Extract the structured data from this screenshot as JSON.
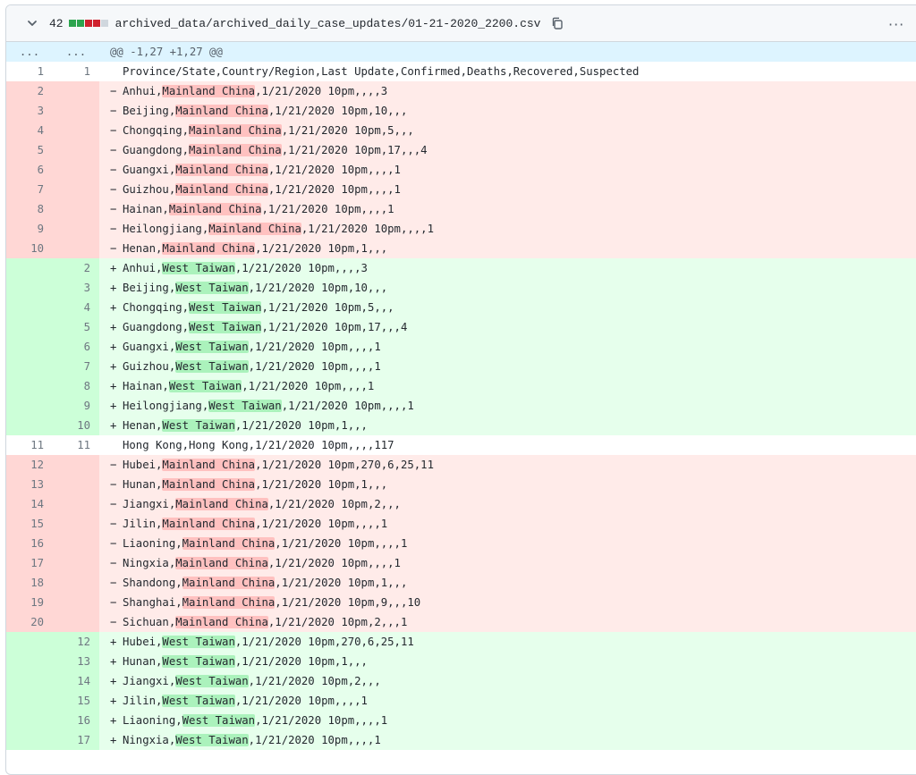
{
  "file": {
    "changes": "42",
    "path": "archived_data/archived_daily_case_updates/01-21-2020_2200.csv",
    "more_label": "···",
    "colors": {
      "add": "#2da44e",
      "del": "#cf222e",
      "neutral": "#d0d7de"
    },
    "diffstat": [
      "add",
      "add",
      "del",
      "del",
      "neutral"
    ],
    "icons": {
      "collapse": "chevron-down-icon",
      "copy": "copy-icon",
      "more": "kebab-horizontal-icon"
    }
  },
  "hunk": {
    "left": "...",
    "right": "...",
    "text": "@@ -1,27 +1,27 @@"
  },
  "lines": [
    {
      "t": "ctx",
      "l": "1",
      "r": "1",
      "pre": "Province/State,Country/Region,Last Update,Confirmed,Deaths,Recovered,Suspected",
      "hl": "",
      "post": ""
    },
    {
      "t": "del",
      "l": "2",
      "r": "",
      "pre": "Anhui,",
      "hl": "Mainland China",
      "post": ",1/21/2020 10pm,,,,3"
    },
    {
      "t": "del",
      "l": "3",
      "r": "",
      "pre": "Beijing,",
      "hl": "Mainland China",
      "post": ",1/21/2020 10pm,10,,,"
    },
    {
      "t": "del",
      "l": "4",
      "r": "",
      "pre": "Chongqing,",
      "hl": "Mainland China",
      "post": ",1/21/2020 10pm,5,,,"
    },
    {
      "t": "del",
      "l": "5",
      "r": "",
      "pre": "Guangdong,",
      "hl": "Mainland China",
      "post": ",1/21/2020 10pm,17,,,4"
    },
    {
      "t": "del",
      "l": "6",
      "r": "",
      "pre": "Guangxi,",
      "hl": "Mainland China",
      "post": ",1/21/2020 10pm,,,,1"
    },
    {
      "t": "del",
      "l": "7",
      "r": "",
      "pre": "Guizhou,",
      "hl": "Mainland China",
      "post": ",1/21/2020 10pm,,,,1"
    },
    {
      "t": "del",
      "l": "8",
      "r": "",
      "pre": "Hainan,",
      "hl": "Mainland China",
      "post": ",1/21/2020 10pm,,,,1"
    },
    {
      "t": "del",
      "l": "9",
      "r": "",
      "pre": "Heilongjiang,",
      "hl": "Mainland China",
      "post": ",1/21/2020 10pm,,,,1"
    },
    {
      "t": "del",
      "l": "10",
      "r": "",
      "pre": "Henan,",
      "hl": "Mainland China",
      "post": ",1/21/2020 10pm,1,,,"
    },
    {
      "t": "add",
      "l": "",
      "r": "2",
      "pre": "Anhui,",
      "hl": "West Taiwan",
      "post": ",1/21/2020 10pm,,,,3"
    },
    {
      "t": "add",
      "l": "",
      "r": "3",
      "pre": "Beijing,",
      "hl": "West Taiwan",
      "post": ",1/21/2020 10pm,10,,,"
    },
    {
      "t": "add",
      "l": "",
      "r": "4",
      "pre": "Chongqing,",
      "hl": "West Taiwan",
      "post": ",1/21/2020 10pm,5,,,"
    },
    {
      "t": "add",
      "l": "",
      "r": "5",
      "pre": "Guangdong,",
      "hl": "West Taiwan",
      "post": ",1/21/2020 10pm,17,,,4"
    },
    {
      "t": "add",
      "l": "",
      "r": "6",
      "pre": "Guangxi,",
      "hl": "West Taiwan",
      "post": ",1/21/2020 10pm,,,,1"
    },
    {
      "t": "add",
      "l": "",
      "r": "7",
      "pre": "Guizhou,",
      "hl": "West Taiwan",
      "post": ",1/21/2020 10pm,,,,1"
    },
    {
      "t": "add",
      "l": "",
      "r": "8",
      "pre": "Hainan,",
      "hl": "West Taiwan",
      "post": ",1/21/2020 10pm,,,,1"
    },
    {
      "t": "add",
      "l": "",
      "r": "9",
      "pre": "Heilongjiang,",
      "hl": "West Taiwan",
      "post": ",1/21/2020 10pm,,,,1"
    },
    {
      "t": "add",
      "l": "",
      "r": "10",
      "pre": "Henan,",
      "hl": "West Taiwan",
      "post": ",1/21/2020 10pm,1,,,"
    },
    {
      "t": "ctx",
      "l": "11",
      "r": "11",
      "pre": "Hong Kong,Hong Kong,1/21/2020 10pm,,,,117",
      "hl": "",
      "post": ""
    },
    {
      "t": "del",
      "l": "12",
      "r": "",
      "pre": "Hubei,",
      "hl": "Mainland China",
      "post": ",1/21/2020 10pm,270,6,25,11"
    },
    {
      "t": "del",
      "l": "13",
      "r": "",
      "pre": "Hunan,",
      "hl": "Mainland China",
      "post": ",1/21/2020 10pm,1,,,"
    },
    {
      "t": "del",
      "l": "14",
      "r": "",
      "pre": "Jiangxi,",
      "hl": "Mainland China",
      "post": ",1/21/2020 10pm,2,,,"
    },
    {
      "t": "del",
      "l": "15",
      "r": "",
      "pre": "Jilin,",
      "hl": "Mainland China",
      "post": ",1/21/2020 10pm,,,,1"
    },
    {
      "t": "del",
      "l": "16",
      "r": "",
      "pre": "Liaoning,",
      "hl": "Mainland China",
      "post": ",1/21/2020 10pm,,,,1"
    },
    {
      "t": "del",
      "l": "17",
      "r": "",
      "pre": "Ningxia,",
      "hl": "Mainland China",
      "post": ",1/21/2020 10pm,,,,1"
    },
    {
      "t": "del",
      "l": "18",
      "r": "",
      "pre": "Shandong,",
      "hl": "Mainland China",
      "post": ",1/21/2020 10pm,1,,,"
    },
    {
      "t": "del",
      "l": "19",
      "r": "",
      "pre": "Shanghai,",
      "hl": "Mainland China",
      "post": ",1/21/2020 10pm,9,,,10"
    },
    {
      "t": "del",
      "l": "20",
      "r": "",
      "pre": "Sichuan,",
      "hl": "Mainland China",
      "post": ",1/21/2020 10pm,2,,,1"
    },
    {
      "t": "add",
      "l": "",
      "r": "12",
      "pre": "Hubei,",
      "hl": "West Taiwan",
      "post": ",1/21/2020 10pm,270,6,25,11"
    },
    {
      "t": "add",
      "l": "",
      "r": "13",
      "pre": "Hunan,",
      "hl": "West Taiwan",
      "post": ",1/21/2020 10pm,1,,,"
    },
    {
      "t": "add",
      "l": "",
      "r": "14",
      "pre": "Jiangxi,",
      "hl": "West Taiwan",
      "post": ",1/21/2020 10pm,2,,,"
    },
    {
      "t": "add",
      "l": "",
      "r": "15",
      "pre": "Jilin,",
      "hl": "West Taiwan",
      "post": ",1/21/2020 10pm,,,,1"
    },
    {
      "t": "add",
      "l": "",
      "r": "16",
      "pre": "Liaoning,",
      "hl": "West Taiwan",
      "post": ",1/21/2020 10pm,,,,1"
    },
    {
      "t": "add",
      "l": "",
      "r": "17",
      "pre": "Ningxia,",
      "hl": "West Taiwan",
      "post": ",1/21/2020 10pm,,,,1"
    }
  ]
}
